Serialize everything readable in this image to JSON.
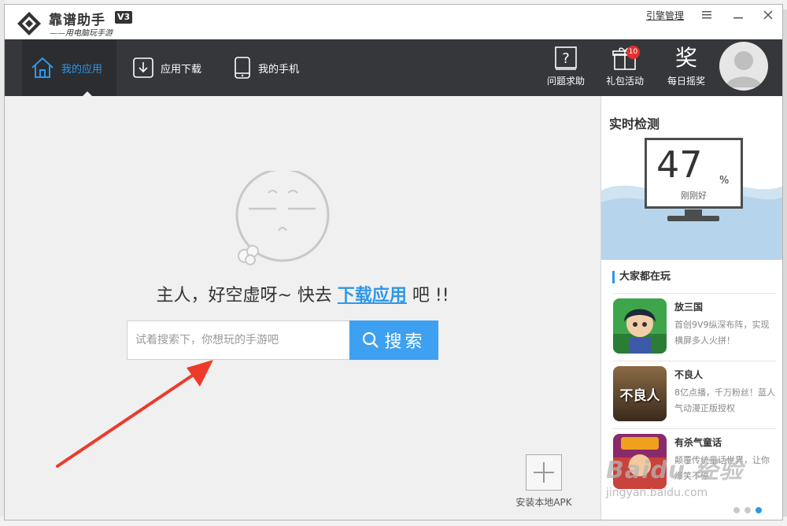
{
  "window": {
    "app_name": "靠谱助手",
    "version": "V3",
    "slogan": "——用电脑玩手游",
    "help_link": "引擎管理",
    "menu_icon": "menu-icon",
    "minimize_icon": "minimize-icon",
    "close_icon": "close-icon"
  },
  "nav": {
    "tabs": [
      {
        "label": "我的应用",
        "icon": "home-icon",
        "active": true
      },
      {
        "label": "应用下载",
        "icon": "download-icon",
        "active": false
      },
      {
        "label": "我的手机",
        "icon": "phone-icon",
        "active": false
      }
    ],
    "tools": [
      {
        "label": "问题求助",
        "icon": "help-icon"
      },
      {
        "label": "礼包活动",
        "icon": "gift-icon",
        "badge": "10"
      },
      {
        "label": "每日摇奖",
        "icon": "lottery-icon",
        "glyph": "奖"
      }
    ]
  },
  "main": {
    "empty_prefix": "主人，好空虚呀~ 快去",
    "empty_link": "下载应用",
    "empty_suffix": "吧 !!",
    "search_placeholder": "试着搜索下，你想玩的手游吧",
    "search_button": "搜索",
    "install_apk": "安装本地APK"
  },
  "right": {
    "title": "实时检测",
    "score": "47",
    "score_unit": "%",
    "score_status": "刚刚好",
    "section_title": "大家都在玩",
    "games": [
      {
        "name": "放三国",
        "desc": "首创9V9纵深布阵，实现横屏多人火拼！"
      },
      {
        "name": "不良人",
        "desc": "8亿点播，千万粉丝！蓝人气动漫正版授权",
        "thumb_text": "不良人"
      },
      {
        "name": "有杀气童话",
        "desc": "颠覆传统童话世界，让你爆笑不停"
      }
    ]
  },
  "watermark": {
    "line1": "Baidu 经验",
    "line2": "jingyan.baidu.com"
  },
  "colors": {
    "accent": "#2e97ea",
    "navbar": "#35373a",
    "badge": "#e03030"
  }
}
